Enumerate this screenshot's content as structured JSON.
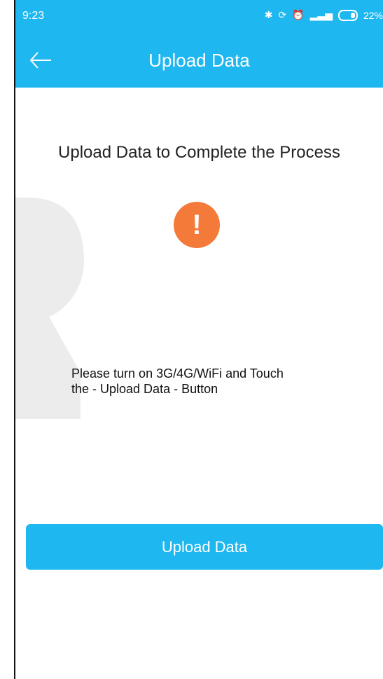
{
  "status_bar": {
    "time": "9:23",
    "battery_text": "22%"
  },
  "app_bar": {
    "title": "Upload Data",
    "back_icon": "arrow-left-icon"
  },
  "content": {
    "headline": "Upload Data to Complete the Process",
    "alert_icon": "exclamation-icon",
    "alert_symbol": "!",
    "instruction_line1": "Please turn on 3G/4G/WiFi and Touch",
    "instruction_line2": "the - Upload Data - Button"
  },
  "actions": {
    "upload_label": "Upload Data"
  },
  "colors": {
    "primary": "#1fb7f0",
    "alert": "#f47a3a",
    "text": "#222222",
    "watermark": "#e9e9e9"
  }
}
